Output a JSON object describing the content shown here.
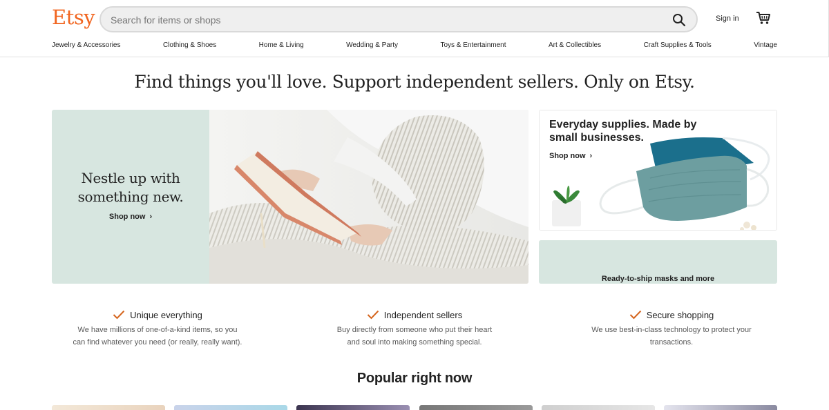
{
  "header": {
    "logo": "Etsy",
    "search_placeholder": "Search for items or shops",
    "search_value": "",
    "sign_in": "Sign in",
    "icons": [
      "search-icon",
      "cart-icon"
    ],
    "brand_color": "#F1641E"
  },
  "categories": [
    "Jewelry & Accessories",
    "Clothing & Shoes",
    "Home & Living",
    "Wedding & Party",
    "Toys & Entertainment",
    "Art & Collectibles",
    "Craft Supplies & Tools",
    "Vintage"
  ],
  "tagline": "Find things you'll love. Support independent sellers. Only on Etsy.",
  "hero": {
    "title_line1": "Nestle up with",
    "title_line2": "something new.",
    "shop_now": "Shop now",
    "panel_color": "#D7E6E0"
  },
  "promo_top": {
    "title": "Everyday supplies. Made by small businesses.",
    "shop_now": "Shop now"
  },
  "promo_bottom": {
    "label": "Ready-to-ship masks and more",
    "panel_color": "#D7E6E0"
  },
  "values": [
    {
      "title": "Unique everything",
      "desc_line1": "We have millions of one-of-a-kind items, so you",
      "desc_line2": "can find whatever you need (or really, really want)."
    },
    {
      "title": "Independent sellers",
      "desc_line1": "Buy directly from someone who put their heart",
      "desc_line2": "and soul into making something special."
    },
    {
      "title": "Secure shopping",
      "desc_line1": "We use best-in-class technology to protect your",
      "desc_line2": "transactions."
    }
  ],
  "check_color": "#D5641C",
  "popular_heading": "Popular right now"
}
